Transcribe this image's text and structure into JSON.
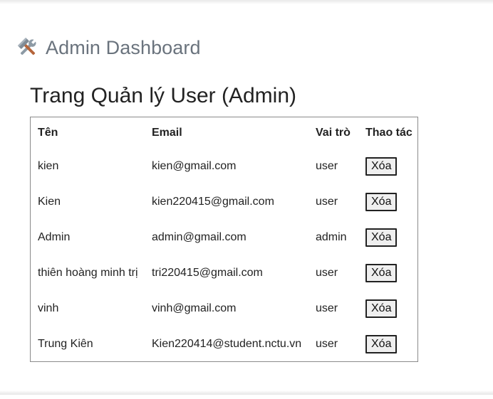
{
  "header": {
    "icon": "hammer-and-wrench-icon",
    "title": "Admin Dashboard"
  },
  "page": {
    "title": "Trang Quản lý User (Admin)"
  },
  "table": {
    "columns": [
      "Tên",
      "Email",
      "Vai trò",
      "Thao tác"
    ],
    "delete_label": "Xóa",
    "rows": [
      {
        "name": "kien",
        "email": "kien@gmail.com",
        "role": "user",
        "action": "Xóa"
      },
      {
        "name": "Kien",
        "email": "kien220415@gmail.com",
        "role": "user",
        "action": "Xóa"
      },
      {
        "name": "Admin",
        "email": "admin@gmail.com",
        "role": "admin",
        "action": "Xóa"
      },
      {
        "name": "thiên hoàng minh trị",
        "email": "tri220415@gmail.com",
        "role": "user",
        "action": "Xóa"
      },
      {
        "name": "vinh",
        "email": "vinh@gmail.com",
        "role": "user",
        "action": "Xóa"
      },
      {
        "name": "Trung Kiên",
        "email": "Kien220414@student.nctu.vn",
        "role": "user",
        "action": "Xóa"
      }
    ]
  },
  "colors": {
    "header_text": "#6a737d",
    "button_bg": "#efefef",
    "table_border": "#8a8a8a"
  }
}
